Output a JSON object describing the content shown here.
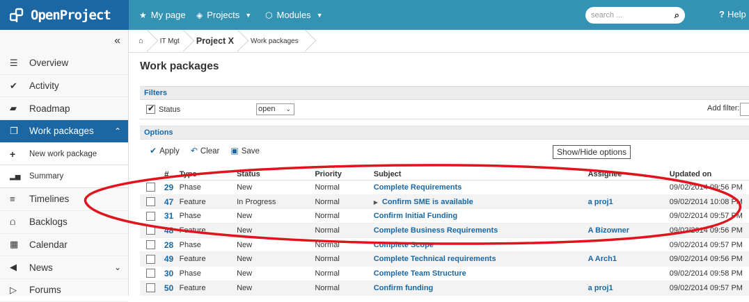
{
  "app": {
    "logo_text": "OpenProject",
    "nav": [
      {
        "label": "My page",
        "icon": "star-icon"
      },
      {
        "label": "Projects",
        "icon": "layers-icon"
      },
      {
        "label": "Modules",
        "icon": "cube-icon"
      }
    ],
    "search_placeholder": "search ...",
    "help_label": "Help"
  },
  "sidebar": {
    "collapse_glyph": "«",
    "items": [
      {
        "label": "Overview",
        "icon": "list-icon"
      },
      {
        "label": "Activity",
        "icon": "check-icon"
      },
      {
        "label": "Roadmap",
        "icon": "tag-icon"
      },
      {
        "label": "Work packages",
        "icon": "work-packages-icon",
        "active": true
      },
      {
        "label": "New work package",
        "icon": "plus-icon"
      },
      {
        "label": "Summary",
        "icon": "bar-chart-icon"
      },
      {
        "label": "Timelines",
        "icon": "timeline-icon"
      },
      {
        "label": "Backlogs",
        "icon": "backlogs-icon"
      },
      {
        "label": "Calendar",
        "icon": "calendar-icon"
      },
      {
        "label": "News",
        "icon": "megaphone-icon"
      },
      {
        "label": "Forums",
        "icon": "forums-icon"
      }
    ]
  },
  "breadcrumb": [
    "IT Mgt",
    "Project X",
    "Work packages"
  ],
  "page_title": "Work packages",
  "filters": {
    "heading": "Filters",
    "status_label": "Status",
    "status_value": "open",
    "add_filter_label": "Add filter:"
  },
  "options": {
    "heading": "Options",
    "apply": "Apply",
    "clear": "Clear",
    "save": "Save",
    "show_hide": "Show/Hide options"
  },
  "table": {
    "columns": [
      "#",
      "Type",
      "Status",
      "Priority",
      "Subject",
      "Assignee",
      "Updated on"
    ],
    "rows": [
      {
        "id": "29",
        "type": "Phase",
        "status": "New",
        "priority": "Normal",
        "subject": "Complete Requirements",
        "assignee": "",
        "updated": "09/02/2014 09:56 PM"
      },
      {
        "id": "47",
        "type": "Feature",
        "status": "In Progress",
        "priority": "Normal",
        "subject": "Confirm SME is available",
        "assignee": "a proj1",
        "updated": "09/02/2014 10:08 PM",
        "has_children": true
      },
      {
        "id": "31",
        "type": "Phase",
        "status": "New",
        "priority": "Normal",
        "subject": "Confirm Initial Funding",
        "assignee": "",
        "updated": "09/02/2014 09:57 PM"
      },
      {
        "id": "48",
        "type": "Feature",
        "status": "New",
        "priority": "Normal",
        "subject": "Complete Business Requirements",
        "assignee": "A Bizowner",
        "updated": "09/02/2014 09:56 PM"
      },
      {
        "id": "28",
        "type": "Phase",
        "status": "New",
        "priority": "Normal",
        "subject": "Complete Scope",
        "assignee": "",
        "updated": "09/02/2014 09:57 PM"
      },
      {
        "id": "49",
        "type": "Feature",
        "status": "New",
        "priority": "Normal",
        "subject": "Complete Technical requirements",
        "assignee": "A Arch1",
        "updated": "09/02/2014 09:56 PM"
      },
      {
        "id": "30",
        "type": "Phase",
        "status": "New",
        "priority": "Normal",
        "subject": "Complete Team Structure",
        "assignee": "",
        "updated": "09/02/2014 09:58 PM"
      },
      {
        "id": "50",
        "type": "Feature",
        "status": "New",
        "priority": "Normal",
        "subject": "Confirm funding",
        "assignee": "a proj1",
        "updated": "09/02/2014 09:57 PM"
      }
    ]
  },
  "annotation_color": "#e0141c",
  "accent_color": "#1a67a3"
}
